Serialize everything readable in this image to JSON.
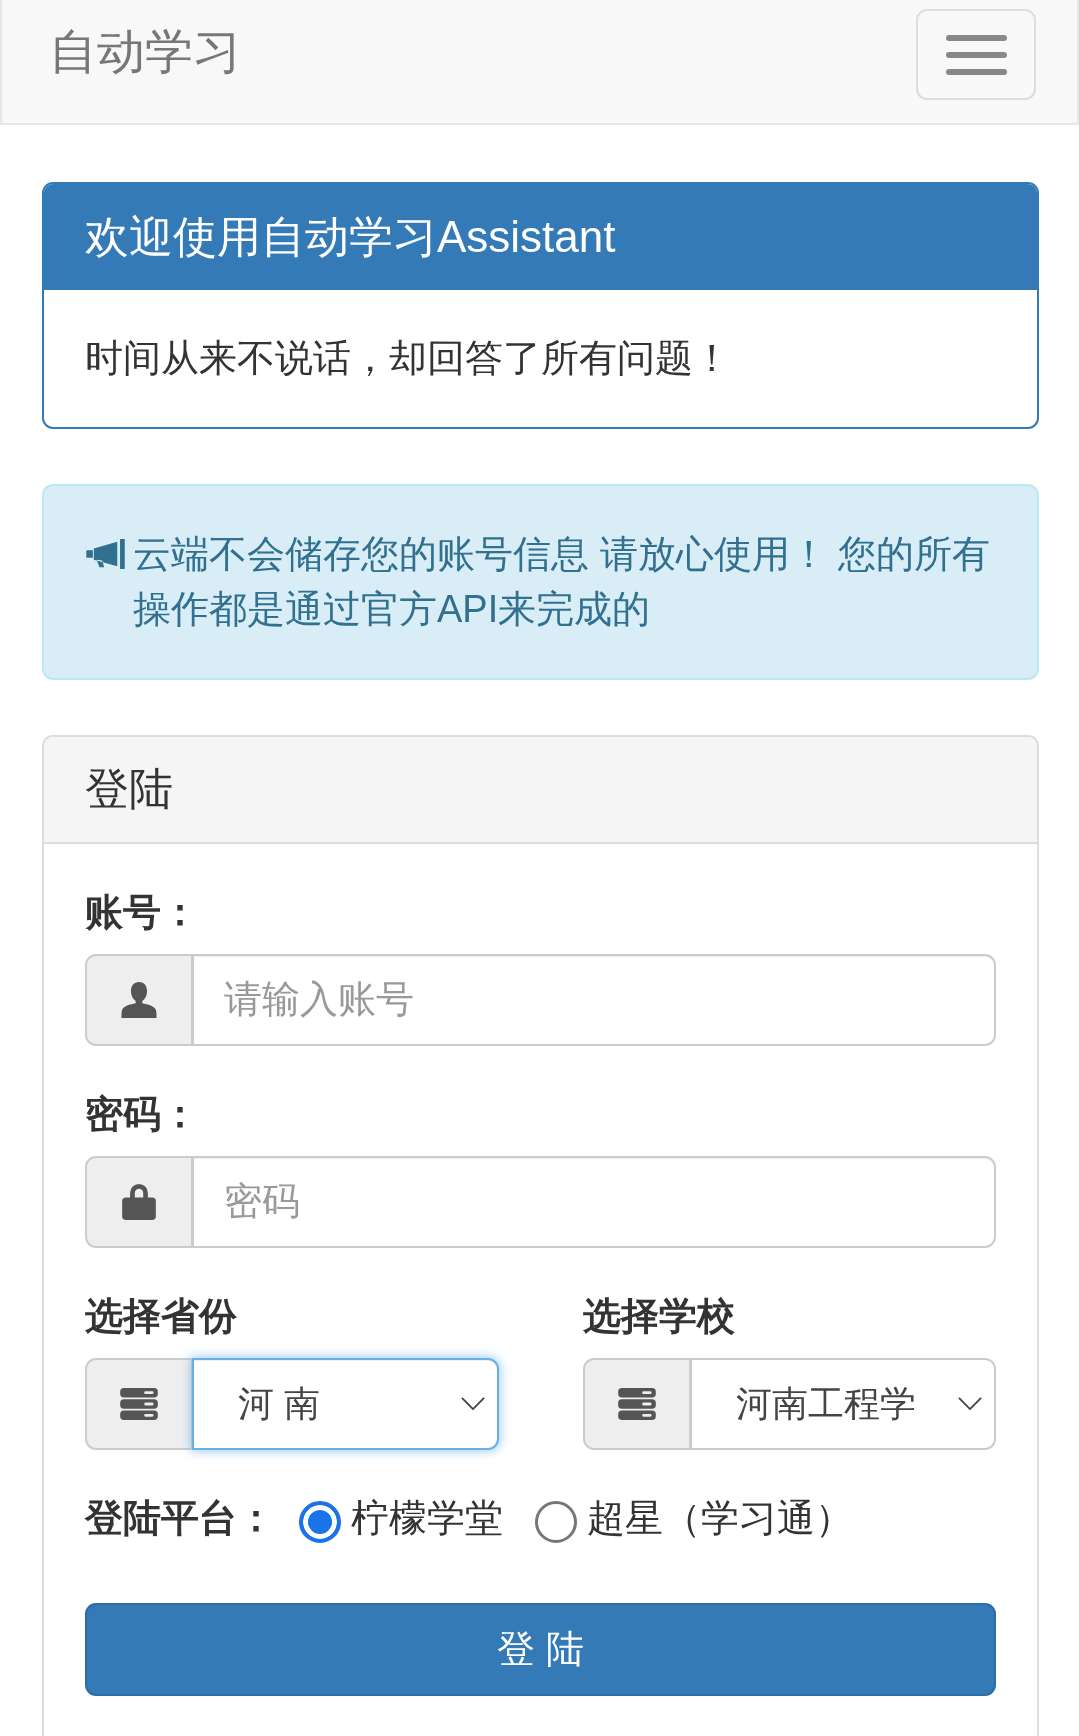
{
  "navbar": {
    "brand": "自动学习"
  },
  "welcome_panel": {
    "title": "欢迎使用自动学习Assistant",
    "body": "时间从来不说话，却回答了所有问题！"
  },
  "notice": {
    "text": "云端不会储存您的账号信息 请放心使用！ 您的所有操作都是通过官方API来完成的"
  },
  "login_panel": {
    "title": "登陆",
    "fields": [
      {
        "kind": "account",
        "label": "账号：",
        "placeholder": "请输入账号"
      },
      {
        "kind": "password",
        "label": "密码：",
        "placeholder": "密码"
      }
    ],
    "selects": [
      {
        "label": "选择省份",
        "value": "河 南",
        "focused": true
      },
      {
        "label": "选择学校",
        "value": "河南工程学",
        "focused": false
      }
    ],
    "platform": {
      "label": "登陆平台：",
      "options": [
        {
          "label": "柠檬学堂",
          "selected": true
        },
        {
          "label": "超星（学习通）",
          "selected": false
        }
      ]
    },
    "submit": "登 陆"
  }
}
